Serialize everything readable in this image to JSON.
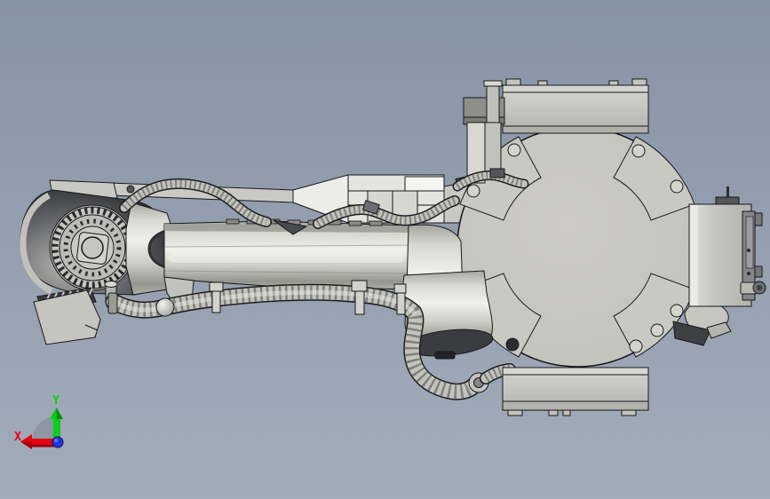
{
  "viewport": {
    "subject": "Top view of an industrial 6-axis robot arm CAD model",
    "background_top": "#8793a6",
    "background_bottom": "#a3acb9",
    "model_colors": {
      "face": "#c8c8c3",
      "highlight": "#efefec",
      "mid_shade": "#a8a8a3",
      "dark_shade": "#57585c",
      "darkest": "#35363a",
      "outline": "#17181b"
    }
  },
  "triad": {
    "x_label": "X",
    "y_label": "Y",
    "x_color": "#e60012",
    "x_dark": "#8f0008",
    "y_color": "#00d214",
    "y_dark": "#007708",
    "z_color": "#2233dd"
  }
}
